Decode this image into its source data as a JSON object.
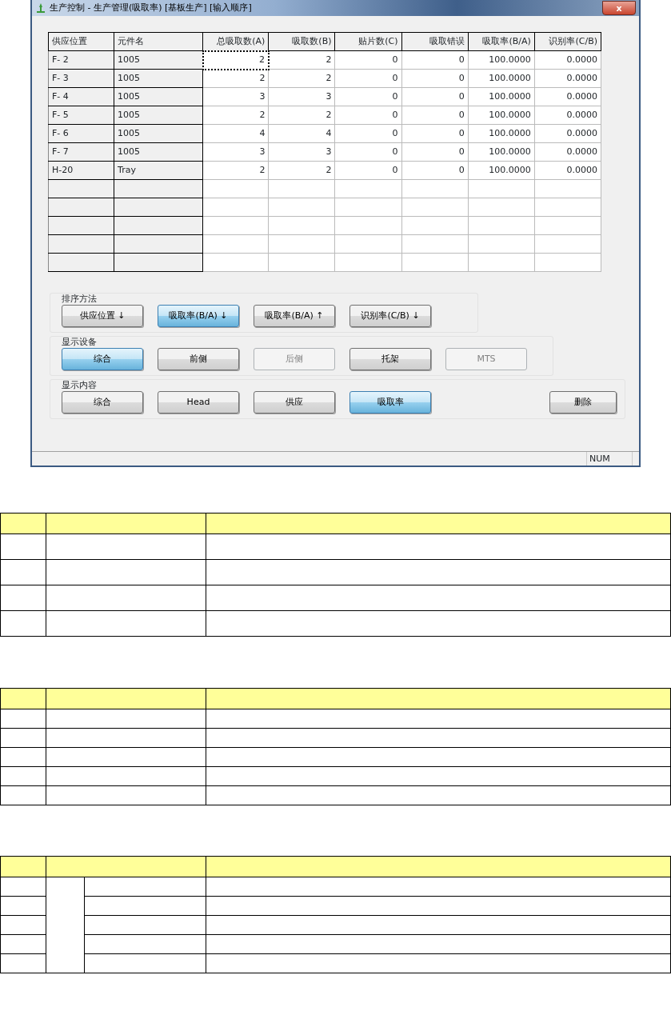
{
  "window": {
    "title": "生产控制 - 生产管理(吸取率) [基板生产] [输入顺序]",
    "close": "x"
  },
  "table": {
    "columns": [
      "供应位置",
      "元件名",
      "总吸取数(A)",
      "吸取数(B)",
      "贴片数(C)",
      "吸取错误",
      "吸取率(B/A)",
      "识别率(C/B)"
    ],
    "rows": [
      {
        "cells": [
          "F- 2",
          "1005",
          "2",
          "2",
          "0",
          "0",
          "100.0000",
          "0.0000"
        ],
        "selected": true
      },
      {
        "cells": [
          "F- 3",
          "1005",
          "2",
          "2",
          "0",
          "0",
          "100.0000",
          "0.0000"
        ],
        "selected": false
      },
      {
        "cells": [
          "F- 4",
          "1005",
          "3",
          "3",
          "0",
          "0",
          "100.0000",
          "0.0000"
        ],
        "selected": false
      },
      {
        "cells": [
          "F- 5",
          "1005",
          "2",
          "2",
          "0",
          "0",
          "100.0000",
          "0.0000"
        ],
        "selected": false
      },
      {
        "cells": [
          "F- 6",
          "1005",
          "4",
          "4",
          "0",
          "0",
          "100.0000",
          "0.0000"
        ],
        "selected": false
      },
      {
        "cells": [
          "F- 7",
          "1005",
          "3",
          "3",
          "0",
          "0",
          "100.0000",
          "0.0000"
        ],
        "selected": false
      },
      {
        "cells": [
          "H-20",
          "Tray",
          "2",
          "2",
          "0",
          "0",
          "100.0000",
          "0.0000"
        ],
        "selected": false
      }
    ]
  },
  "groups": [
    {
      "label": "排序方法",
      "buttons": [
        {
          "label": "供应位置 ↓",
          "selected": false,
          "disabled": false
        },
        {
          "label": "吸取率(B/A) ↓",
          "selected": true,
          "disabled": false
        },
        {
          "label": "吸取率(B/A) ↑",
          "selected": false,
          "disabled": false
        },
        {
          "label": "识别率(C/B) ↓",
          "selected": false,
          "disabled": false
        }
      ]
    },
    {
      "label": "显示设备",
      "buttons": [
        {
          "label": "综合",
          "selected": true,
          "disabled": false
        },
        {
          "label": "前侧",
          "selected": false,
          "disabled": false
        },
        {
          "label": "后侧",
          "selected": false,
          "disabled": true
        },
        {
          "label": "托架",
          "selected": false,
          "disabled": false
        },
        {
          "label": "MTS",
          "selected": false,
          "disabled": true
        }
      ]
    },
    {
      "label": "显示内容",
      "buttons": [
        {
          "label": "综合",
          "selected": false,
          "disabled": false
        },
        {
          "label": "Head",
          "selected": false,
          "disabled": false
        },
        {
          "label": "供应",
          "selected": false,
          "disabled": false
        },
        {
          "label": "吸取率",
          "selected": true,
          "disabled": false
        }
      ],
      "extra_button": "删除"
    }
  ],
  "status_bar": {
    "num": "NUM"
  }
}
